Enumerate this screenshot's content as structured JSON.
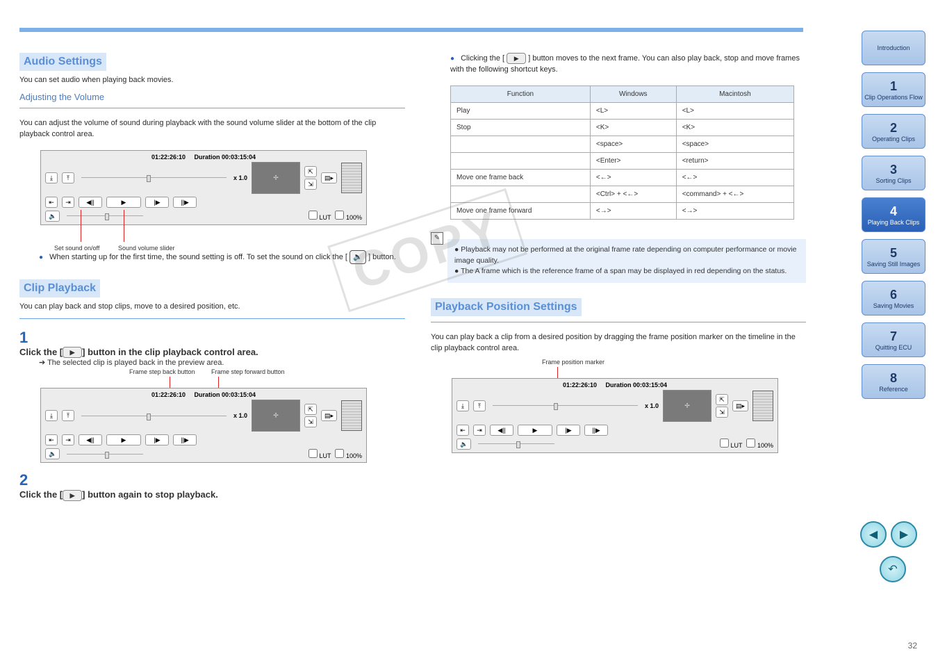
{
  "colors": {
    "accent": "#2764b8",
    "header": "#5a8fd6",
    "rule": "#6da6e6"
  },
  "topbar": {},
  "left": {
    "h_audio": "Audio Settings",
    "h_audio_sub": "You can set audio when playing back movies.",
    "section_vol": "Adjusting the Volume",
    "vol_text": "You can adjust the volume of sound during playback with the sound volume slider at the bottom of the clip playback control area.",
    "vol_marker1": "Set sound on/off",
    "vol_marker2": "Sound volume slider",
    "vol_note": "When starting up for the first time, the sound setting is off. To set the sound on click the [ {icon} ] button.",
    "section_playback": "Clip Playback",
    "playback_text": "You can play back and stop clips, move to a desired position, etc.",
    "step1_label": "Click the [ {icon} ] button in the clip playback control area.",
    "step1_sub": "The selected clip is played back in the preview area.",
    "step1_marker1": "Frame step back button",
    "step1_marker2": "Frame step forward button",
    "step2_label": "Click the [ {icon} ] button again to stop playback."
  },
  "right": {
    "playlabel_prefix": "Clicking the [",
    "playlabel_suffix": "] button moves to the next frame. You can also play back, stop and move frames with the following shortcut keys.",
    "tbl_head1": "Function",
    "tbl_head2": "Windows",
    "tbl_head3": "Macintosh",
    "rows": [
      {
        "f": "Play",
        "w": "<L>",
        "m": "<L>"
      },
      {
        "f": "Stop",
        "w": "<K>",
        "m": "<K>"
      },
      {
        "f": "",
        "w": "<space>",
        "m": "<space>"
      },
      {
        "f": "",
        "w": "<Enter>",
        "m": "<return>"
      },
      {
        "f": "Move one frame back",
        "w": "<←>",
        "m": "<←>"
      },
      {
        "f": "",
        "w": "<Ctrl> + <←>",
        "m": "<command> + <←>"
      },
      {
        "f": "Move one frame forward",
        "w": "<→>",
        "m": "<→>"
      }
    ],
    "note_line1": "Playback may not be performed at the original frame rate depending on computer performance or movie image quality.",
    "note_line2": "The A frame which is the reference frame of a span may be displayed in red depending on the status.",
    "h_pos": "Playback Position Settings",
    "pos_text": "You can play back a clip from a desired position by dragging the frame position marker on the timeline in the clip playback control area.",
    "pos_marker": "Frame position marker"
  },
  "controlbar": {
    "tc": "01:22:26:10",
    "dur_label": "Duration",
    "dur": "00:03:15:04",
    "speed": "x 1.0",
    "lut": "LUT",
    "pct": "100%"
  },
  "sidebar": [
    {
      "label": "Introduction",
      "active": false
    },
    {
      "n": "1",
      "label": "Clip Operations Flow",
      "active": false
    },
    {
      "n": "2",
      "label": "Operating Clips",
      "active": false
    },
    {
      "n": "3",
      "label": "Sorting Clips",
      "active": false
    },
    {
      "n": "4",
      "label": "Playing Back Clips",
      "active": true
    },
    {
      "n": "5",
      "label": "Saving Still Images",
      "active": false
    },
    {
      "n": "6",
      "label": "Saving Movies",
      "active": false
    },
    {
      "n": "7",
      "label": "Quitting ECU",
      "active": false
    },
    {
      "n": "8",
      "label": "Reference",
      "active": false
    }
  ],
  "pager": {
    "prev": "◀",
    "next": "▶",
    "back": "↶"
  },
  "pageno": "32",
  "watermark": "COPY",
  "icons": {
    "play": "▶",
    "sound": "🔈",
    "note": "✎"
  }
}
